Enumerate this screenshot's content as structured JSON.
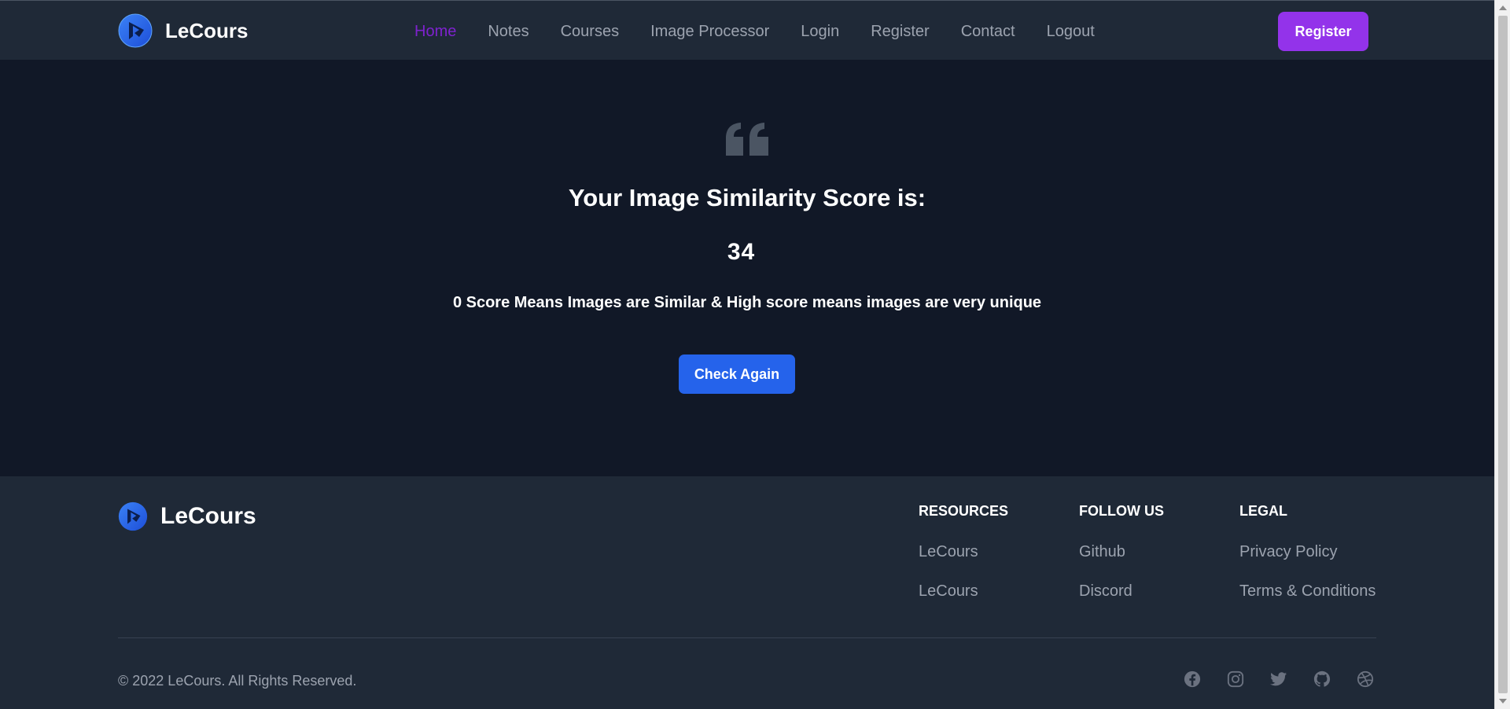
{
  "header": {
    "brand": "LeCours",
    "nav": [
      {
        "label": "Home",
        "active": true
      },
      {
        "label": "Notes"
      },
      {
        "label": "Courses"
      },
      {
        "label": "Image Processor"
      },
      {
        "label": "Login"
      },
      {
        "label": "Register"
      },
      {
        "label": "Contact"
      },
      {
        "label": "Logout"
      }
    ],
    "register_button": "Register"
  },
  "hero": {
    "icon": "quote-icon",
    "title": "Your Image Similarity Score is:",
    "score": "34",
    "description": "0 Score Means Images are Similar & High score means images are very unique",
    "check_button": "Check Again"
  },
  "footer": {
    "brand": "LeCours",
    "columns": [
      {
        "heading": "RESOURCES",
        "links": [
          "LeCours",
          "LeCours"
        ]
      },
      {
        "heading": "FOLLOW US",
        "links": [
          "Github",
          "Discord"
        ]
      },
      {
        "heading": "LEGAL",
        "links": [
          "Privacy Policy",
          "Terms & Conditions"
        ]
      }
    ],
    "copyright": "© 2022 LeCours. All Rights Reserved.",
    "socials": [
      "facebook-icon",
      "instagram-icon",
      "twitter-icon",
      "github-icon",
      "dribbble-icon"
    ]
  },
  "colors": {
    "background": "#111827",
    "header_bg": "#1f2937",
    "active_nav": "#7e22ce",
    "register_button": "#9333ea",
    "check_button": "#2563eb",
    "muted_text": "#9ca3af"
  }
}
